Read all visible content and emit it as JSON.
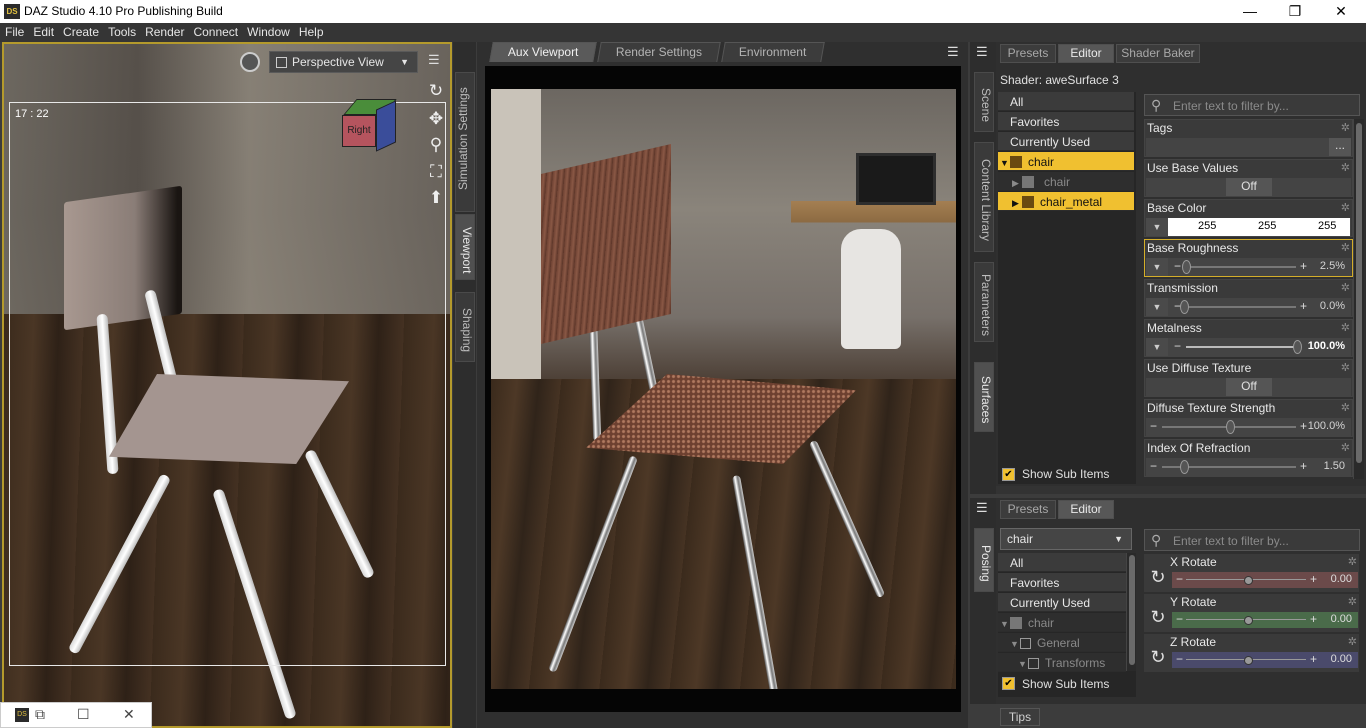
{
  "window": {
    "title": "DAZ Studio 4.10 Pro Publishing Build",
    "logo": "DS",
    "min": "—",
    "max": "❐",
    "close": "✕"
  },
  "menu": [
    "File",
    "Edit",
    "Create",
    "Tools",
    "Render",
    "Connect",
    "Window",
    "Help"
  ],
  "viewport": {
    "view": "Perspective View",
    "frame": "17 : 22",
    "cube_face": "Right"
  },
  "left_tabs": [
    "Simulation Settings",
    "Viewport",
    "Shaping"
  ],
  "center": {
    "tabs": [
      "Aux Viewport",
      "Render Settings",
      "Environment"
    ]
  },
  "right_tabs": [
    "Scene",
    "Content Library",
    "Parameters",
    "Surfaces"
  ],
  "right_tabs2": [
    "Posing"
  ],
  "surfaces": {
    "tabs": [
      "Presets",
      "Editor",
      "Shader Baker"
    ],
    "shader": "Shader: aweSurface 3",
    "filter_placeholder": "Enter text to filter by...",
    "list": [
      "All",
      "Favorites",
      "Currently Used",
      "chair",
      "chair",
      "chair_metal"
    ],
    "show_sub": "Show Sub Items",
    "props": {
      "tags": "Tags",
      "tags_btn": "...",
      "use_base": "Use Base Values",
      "use_base_val": "Off",
      "base_color": "Base Color",
      "r": "255",
      "g": "255",
      "b": "255",
      "base_rough": "Base Roughness",
      "base_rough_val": "2.5%",
      "transmission": "Transmission",
      "transmission_val": "0.0%",
      "metalness": "Metalness",
      "metalness_val": "100.0%",
      "use_diffuse": "Use Diffuse Texture",
      "use_diffuse_val": "Off",
      "diffuse_strength": "Diffuse Texture Strength",
      "diffuse_strength_val": "100.0%",
      "ior": "Index Of Refraction",
      "ior_val": "1.50"
    }
  },
  "posing": {
    "tabs": [
      "Presets",
      "Editor"
    ],
    "node": "chair",
    "filter_placeholder": "Enter text to filter by...",
    "list": [
      "All",
      "Favorites",
      "Currently Used",
      "chair",
      "General",
      "Transforms"
    ],
    "show_sub": "Show Sub Items",
    "x": "X Rotate",
    "x_val": "0.00",
    "y": "Y Rotate",
    "y_val": "0.00",
    "z": "Z Rotate",
    "z_val": "0.00",
    "tips": "Tips"
  },
  "colors": {
    "accent": "#f0c030",
    "viewport_border": "#b49a2c"
  }
}
